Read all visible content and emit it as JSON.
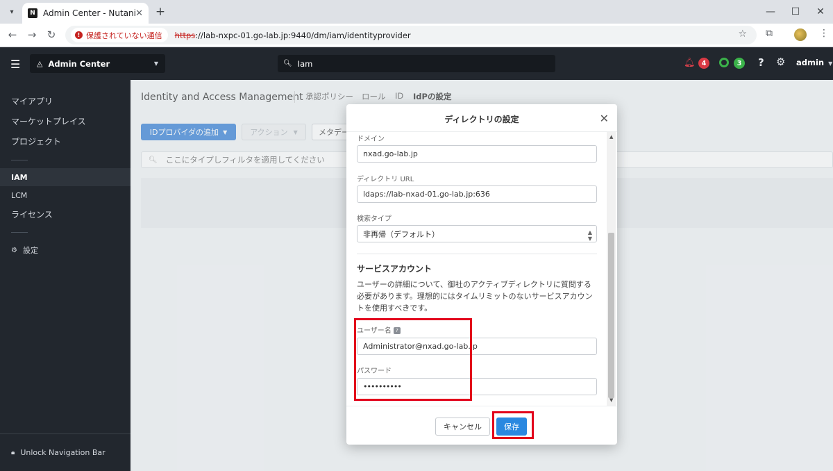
{
  "browser": {
    "tab_title": "Admin Center - Nutanix",
    "tab_favicon": "N",
    "security_label": "保護されていない通信",
    "url_scheme": "https",
    "url_rest": "://lab-nxpc-01.go-lab.jp:9440/dm/iam/identityprovider"
  },
  "header": {
    "app_name": "Admin Center",
    "search_value": "Iam",
    "alerts_count": "4",
    "tasks_count": "3",
    "help_label": "?",
    "user_label": "admin",
    "alert_color": "#d93a45",
    "task_color": "#3bb24a"
  },
  "sidebar": {
    "items": [
      "マイアプリ",
      "マーケットプレイス",
      "プロジェクト"
    ],
    "iam": "IAM",
    "lcm": "LCM",
    "license": "ライセンス",
    "settings": "設定",
    "unlock": "Unlock Navigation Bar"
  },
  "page": {
    "title": "Identity and Access Management",
    "tabs": [
      "承認ポリシー",
      "ロール",
      "ID",
      "IdPの設定"
    ],
    "add_idp_button": "IDプロバイダの追加",
    "action_button": "アクション",
    "metadata_button": "メタデー",
    "filter_placeholder": "ここにタイプしフィルタを適用してください"
  },
  "modal": {
    "title": "ディレクトリの設定",
    "domain_label": "ドメイン",
    "domain_value": "nxad.go-lab.jp",
    "url_label": "ディレクトリ URL",
    "url_value": "ldaps://lab-nxad-01.go-lab.jp:636",
    "search_type_label": "検索タイプ",
    "search_type_value": "非再帰（デフォルト）",
    "service_account_title": "サービスアカウント",
    "service_account_desc": "ユーザーの詳細について、御社のアクティブディレクトリに質問する必要があります。理想的にはタイムリミットのないサービスアカウントを使用すべきです。",
    "username_label": "ユーザー名",
    "username_value": "Administrator@nxad.go-lab.jp",
    "password_label": "パスワード",
    "password_value": "••••••••••",
    "cancel_button": "キャンセル",
    "save_button": "保存"
  },
  "colors": {
    "annotation": "#e2001a",
    "primary": "#2b7ad6"
  }
}
